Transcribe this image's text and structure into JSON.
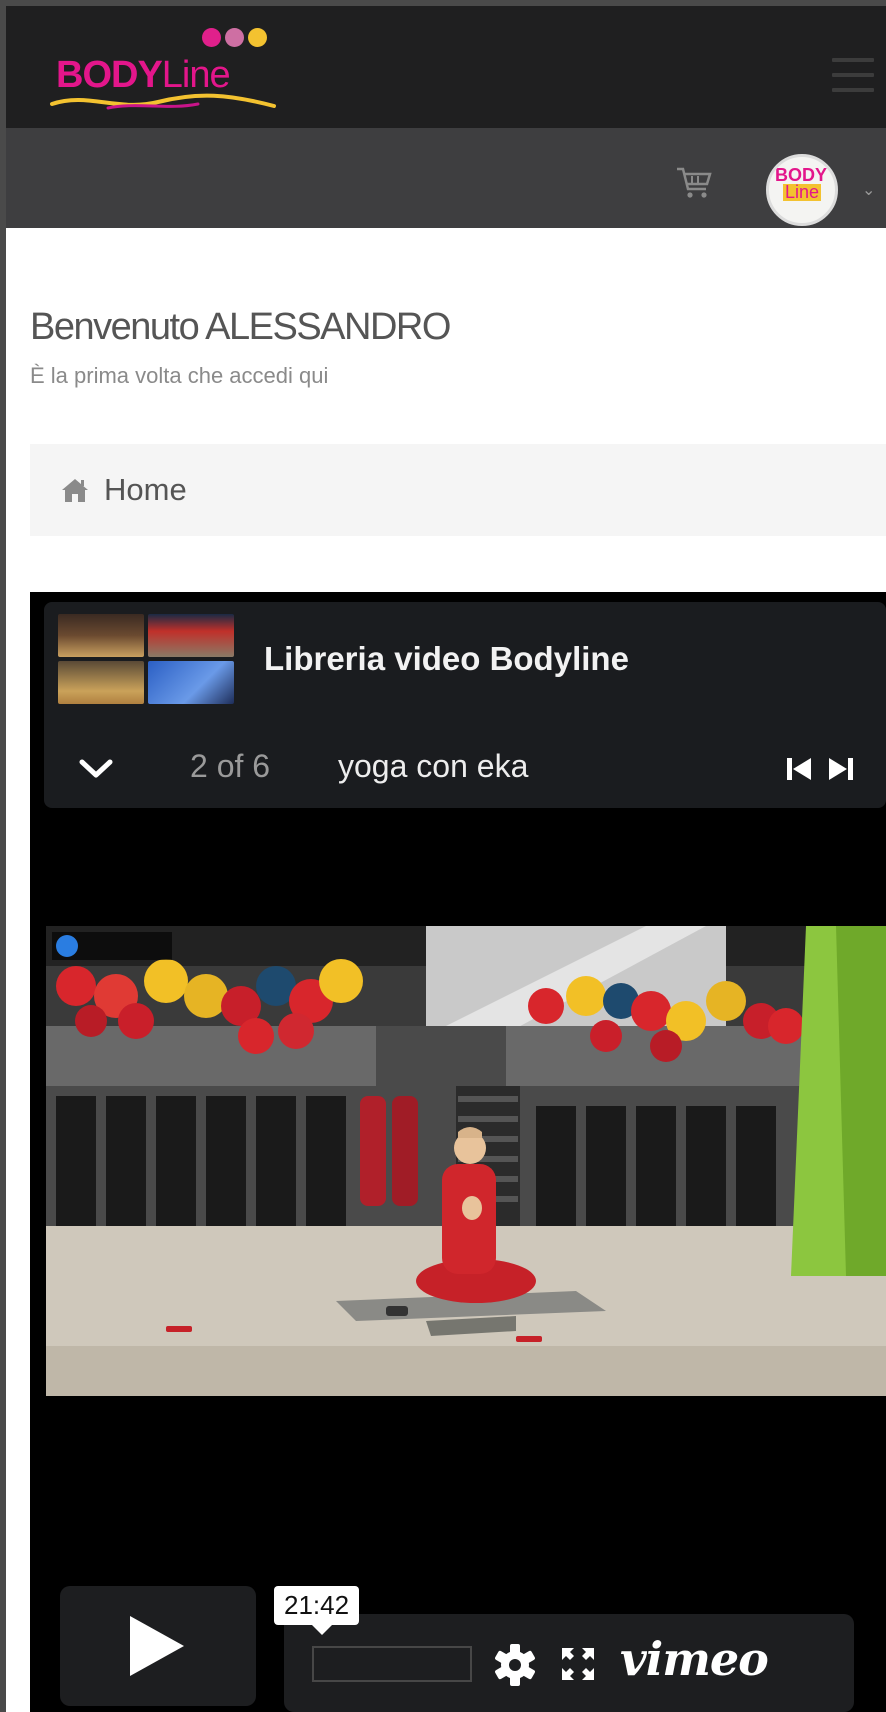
{
  "header": {
    "brand_body": "BODY",
    "brand_line": "Line",
    "social_dots": [
      "#e0208b",
      "#ce6fa3",
      "#f3c230"
    ],
    "avatar_brand_top": "BODY",
    "avatar_brand_bottom": "Line"
  },
  "welcome": {
    "title": "Benvenuto ALESSANDRO",
    "subtitle": "È la prima volta che accedi qui"
  },
  "breadcrumb": {
    "home_label": "Home"
  },
  "player": {
    "playlist_title": "Libreria video Bodyline",
    "position_label": "2 of 6",
    "current_title": "yoga con eka",
    "timestamp": "21:42",
    "brand": "vimeo"
  },
  "colors": {
    "brand_pink": "#e3168b",
    "brand_yellow": "#f3c230",
    "header_dark": "#1f1f20",
    "subbar": "#3e3e40"
  }
}
